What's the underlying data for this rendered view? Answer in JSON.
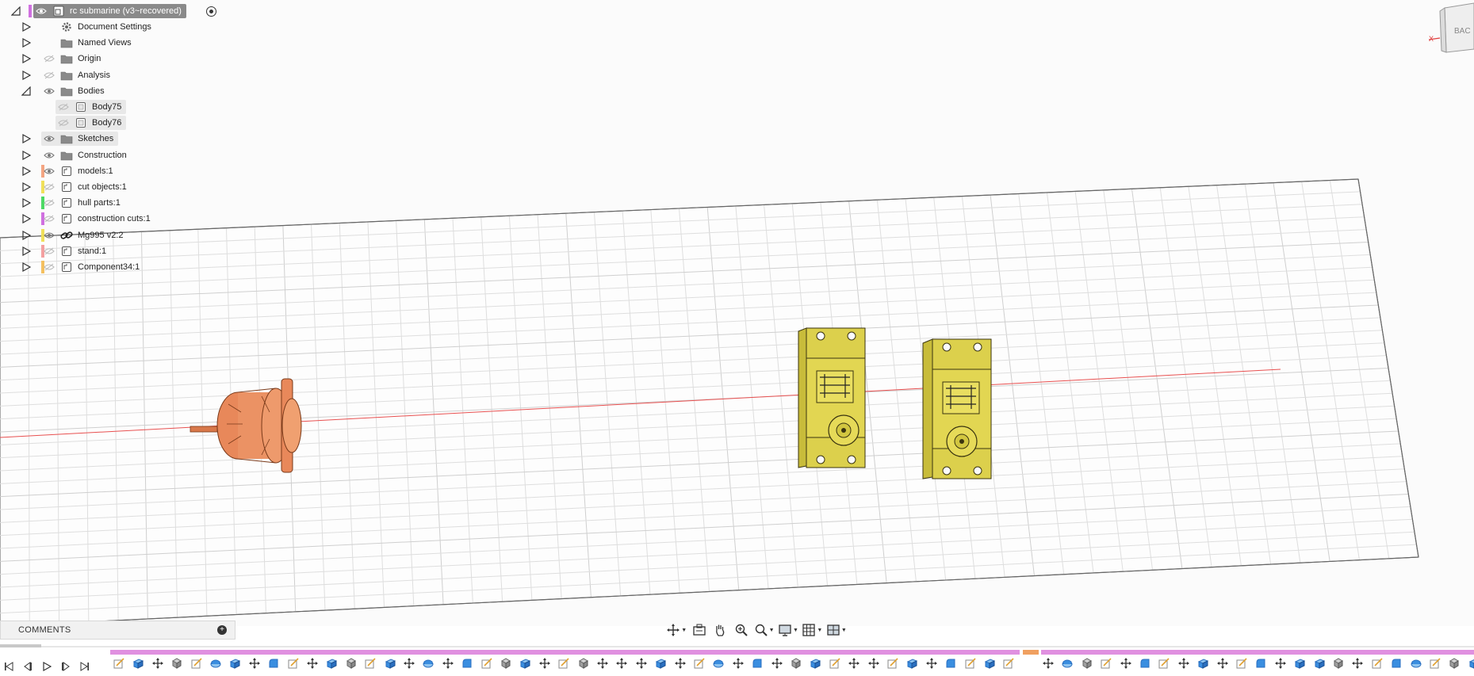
{
  "browser": {
    "root_label": "rc submarine (v3~recovered)",
    "items": [
      {
        "label": "Document Settings",
        "icon": "gear-icon",
        "visible": null,
        "tag": null,
        "expanded": false
      },
      {
        "label": "Named Views",
        "icon": "folder-icon",
        "visible": null,
        "tag": null,
        "expanded": false
      },
      {
        "label": "Origin",
        "icon": "folder-icon",
        "visible": false,
        "tag": null,
        "expanded": false
      },
      {
        "label": "Analysis",
        "icon": "folder-icon",
        "visible": false,
        "tag": null,
        "expanded": false
      },
      {
        "label": "Bodies",
        "icon": "folder-icon",
        "visible": true,
        "tag": null,
        "expanded": true
      },
      {
        "label": "Body75",
        "icon": "body-icon",
        "visible": false,
        "tag": null,
        "child": true
      },
      {
        "label": "Body76",
        "icon": "body-icon",
        "visible": false,
        "tag": null,
        "child": true
      },
      {
        "label": "Sketches",
        "icon": "folder-icon",
        "visible": true,
        "tag": null,
        "expanded": false
      },
      {
        "label": "Construction",
        "icon": "folder-icon",
        "visible": true,
        "tag": null,
        "expanded": false
      },
      {
        "label": "models:1",
        "icon": "component-icon",
        "visible": true,
        "tag": "#f4a582",
        "expanded": false
      },
      {
        "label": "cut objects:1",
        "icon": "component-icon",
        "visible": false,
        "tag": "#f0e05a",
        "expanded": false
      },
      {
        "label": "hull parts:1",
        "icon": "component-icon",
        "visible": false,
        "tag": "#4cd964",
        "expanded": false
      },
      {
        "label": "construction cuts:1",
        "icon": "component-icon",
        "visible": false,
        "tag": "#d070e0",
        "expanded": false
      },
      {
        "label": "Mg995 v2:2",
        "icon": "link-icon",
        "visible": true,
        "tag": "#f0e05a",
        "expanded": false
      },
      {
        "label": "stand:1",
        "icon": "component-icon",
        "visible": false,
        "tag": "#f4a0a0",
        "expanded": false
      },
      {
        "label": "Component34:1",
        "icon": "component-icon",
        "visible": false,
        "tag": "#f4c060",
        "expanded": false
      }
    ]
  },
  "comments": {
    "title": "COMMENTS",
    "add_icon": "plus-icon"
  },
  "navbar": {
    "buttons": [
      {
        "name": "orbit-button",
        "icon": "orbit-icon",
        "dropdown": true
      },
      {
        "name": "look-at-button",
        "icon": "look-at-icon",
        "dropdown": false
      },
      {
        "name": "pan-button",
        "icon": "pan-hand-icon",
        "dropdown": false
      },
      {
        "name": "zoom-button",
        "icon": "zoom-icon",
        "dropdown": false
      },
      {
        "name": "fit-button",
        "icon": "zoom-window-icon",
        "dropdown": true
      },
      {
        "name": "display-settings-button",
        "icon": "display-settings-icon",
        "dropdown": true
      },
      {
        "name": "grid-settings-button",
        "icon": "grid-icon",
        "dropdown": true
      },
      {
        "name": "viewports-button",
        "icon": "viewports-icon",
        "dropdown": true
      }
    ]
  },
  "viewcube": {
    "face_label": "BAC",
    "axis_label": "X"
  },
  "timeline": {
    "controls": [
      "skip-to-start-icon",
      "step-back-icon",
      "play-icon",
      "step-forward-icon",
      "skip-to-end-icon"
    ]
  },
  "colors": {
    "motor": "#e8885a",
    "servo": "#d8cc4a",
    "grid": "#dcdcdc",
    "x_axis": "#e04040",
    "timeline_component": "#e090e0",
    "timeline_marker": "#f0a060"
  }
}
